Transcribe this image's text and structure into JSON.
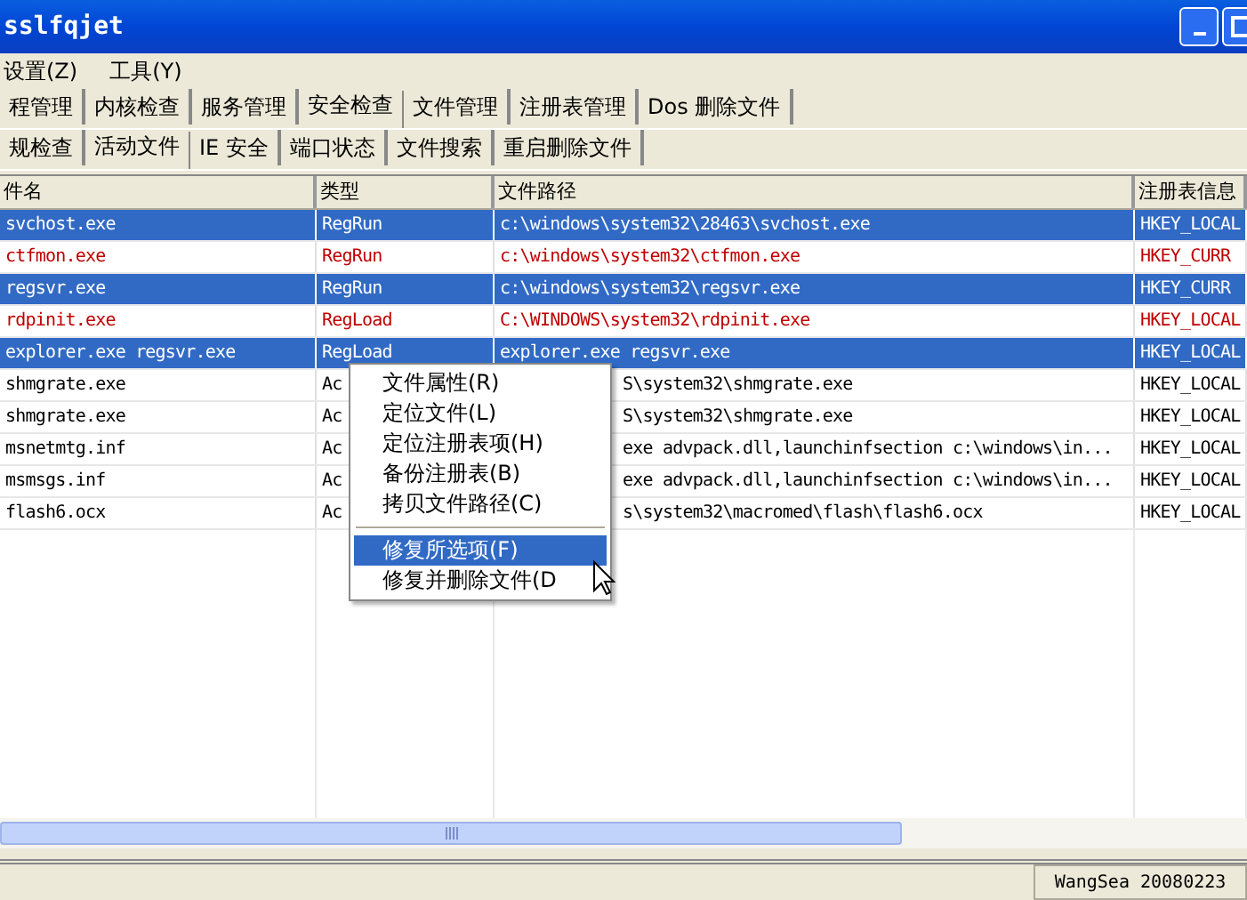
{
  "window": {
    "title": "sslfqjet"
  },
  "menu": [
    "设置(Z)",
    "工具(Y)"
  ],
  "tabs": [
    {
      "label": "程管理",
      "selected": false
    },
    {
      "label": "内核检查",
      "selected": false
    },
    {
      "label": "服务管理",
      "selected": false
    },
    {
      "label": "安全检查",
      "selected": true
    },
    {
      "label": "文件管理",
      "selected": false
    },
    {
      "label": "注册表管理",
      "selected": false
    },
    {
      "label": "Dos 删除文件",
      "selected": false
    }
  ],
  "subtabs": [
    {
      "label": "规检查",
      "selected": false
    },
    {
      "label": "活动文件",
      "selected": true
    },
    {
      "label": "IE 安全",
      "selected": false
    },
    {
      "label": "端口状态",
      "selected": false
    },
    {
      "label": "文件搜索",
      "selected": false
    },
    {
      "label": "重启删除文件",
      "selected": false
    }
  ],
  "table": {
    "columns": [
      "件名",
      "类型",
      "文件路径",
      "注册表信息"
    ],
    "rows": [
      {
        "cells": [
          "svchost.exe",
          "RegRun",
          "c:\\windows\\system32\\28463\\svchost.exe",
          "HKEY_LOCAL"
        ],
        "selected": true,
        "warning": false
      },
      {
        "cells": [
          "ctfmon.exe",
          "RegRun",
          "c:\\windows\\system32\\ctfmon.exe",
          "HKEY_CURR"
        ],
        "selected": false,
        "warning": true
      },
      {
        "cells": [
          "regsvr.exe",
          "RegRun",
          "c:\\windows\\system32\\regsvr.exe",
          "HKEY_CURR"
        ],
        "selected": true,
        "warning": false
      },
      {
        "cells": [
          "rdpinit.exe",
          "RegLoad",
          "C:\\WINDOWS\\system32\\rdpinit.exe",
          "HKEY_LOCAL"
        ],
        "selected": false,
        "warning": true
      },
      {
        "cells": [
          "explorer.exe regsvr.exe",
          "RegLoad",
          "explorer.exe regsvr.exe",
          "HKEY_LOCAL"
        ],
        "selected": true,
        "warning": false
      },
      {
        "cells": [
          "shmgrate.exe",
          "Ac",
          "S\\system32\\shmgrate.exe",
          "HKEY_LOCAL"
        ],
        "selected": false,
        "warning": false
      },
      {
        "cells": [
          "shmgrate.exe",
          "Ac",
          "S\\system32\\shmgrate.exe",
          "HKEY_LOCAL"
        ],
        "selected": false,
        "warning": false
      },
      {
        "cells": [
          "msnetmtg.inf",
          "Ac",
          "exe advpack.dll,launchinfsection c:\\windows\\in...",
          "HKEY_LOCAL"
        ],
        "selected": false,
        "warning": false
      },
      {
        "cells": [
          "msmsgs.inf",
          "Ac",
          "exe advpack.dll,launchinfsection c:\\windows\\in...",
          "HKEY_LOCAL"
        ],
        "selected": false,
        "warning": false
      },
      {
        "cells": [
          "flash6.ocx",
          "Ac",
          "s\\system32\\macromed\\flash\\flash6.ocx",
          "HKEY_LOCAL"
        ],
        "selected": false,
        "warning": false
      }
    ]
  },
  "context_menu": {
    "items": [
      {
        "label": "文件属性(R)",
        "selected": false
      },
      {
        "label": "定位文件(L)",
        "selected": false
      },
      {
        "label": "定位注册表项(H)",
        "selected": false
      },
      {
        "label": "备份注册表(B)",
        "selected": false
      },
      {
        "label": "拷贝文件路径(C)",
        "selected": false
      },
      {
        "label": "修复所选项(F)",
        "selected": true
      },
      {
        "label": "修复并删除文件(D",
        "selected": false
      }
    ]
  },
  "status_bar": "WangSea 20080223"
}
